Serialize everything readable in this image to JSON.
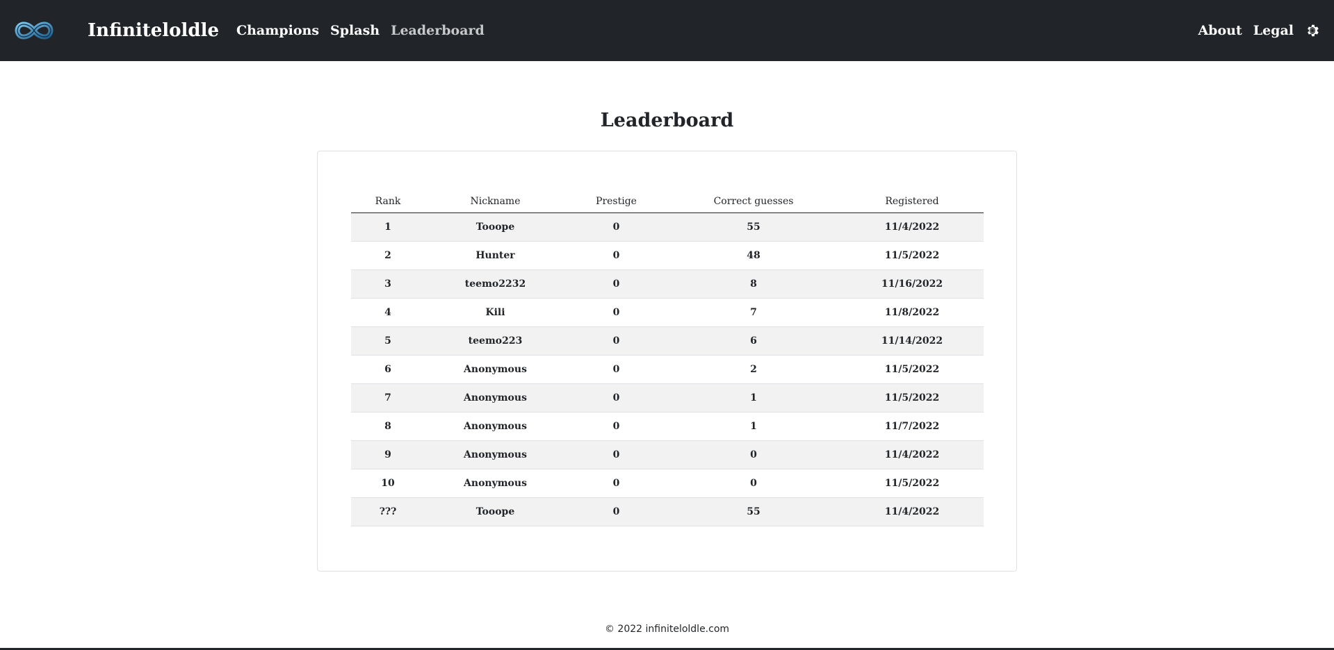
{
  "nav": {
    "brand": "Infiniteloldle",
    "links": [
      "Champions",
      "Splash",
      "Leaderboard"
    ],
    "active_link": "Leaderboard",
    "right_links": [
      "About",
      "Legal"
    ],
    "logo_icon": "infinity-logo-icon",
    "settings_icon": "gear-icon"
  },
  "page": {
    "title": "Leaderboard"
  },
  "leaderboard": {
    "columns": [
      "Rank",
      "Nickname",
      "Prestige",
      "Correct guesses",
      "Registered"
    ],
    "rows": [
      [
        "1",
        "Tooope",
        "0",
        "55",
        "11/4/2022"
      ],
      [
        "2",
        "Hunter",
        "0",
        "48",
        "11/5/2022"
      ],
      [
        "3",
        "teemo2232",
        "0",
        "8",
        "11/16/2022"
      ],
      [
        "4",
        "Kili",
        "0",
        "7",
        "11/8/2022"
      ],
      [
        "5",
        "teemo223",
        "0",
        "6",
        "11/14/2022"
      ],
      [
        "6",
        "Anonymous",
        "0",
        "2",
        "11/5/2022"
      ],
      [
        "7",
        "Anonymous",
        "0",
        "1",
        "11/5/2022"
      ],
      [
        "8",
        "Anonymous",
        "0",
        "1",
        "11/7/2022"
      ],
      [
        "9",
        "Anonymous",
        "0",
        "0",
        "11/4/2022"
      ],
      [
        "10",
        "Anonymous",
        "0",
        "0",
        "11/5/2022"
      ]
    ],
    "current_user": [
      "???",
      "Tooope",
      "0",
      "55",
      "11/4/2022"
    ]
  },
  "footer": {
    "text": "© 2022 infiniteloldle.com"
  },
  "colors": {
    "navbar_bg": "#212529",
    "stripe_bg": "#f2f2f2",
    "logo_blue": "#3b8fc4"
  }
}
